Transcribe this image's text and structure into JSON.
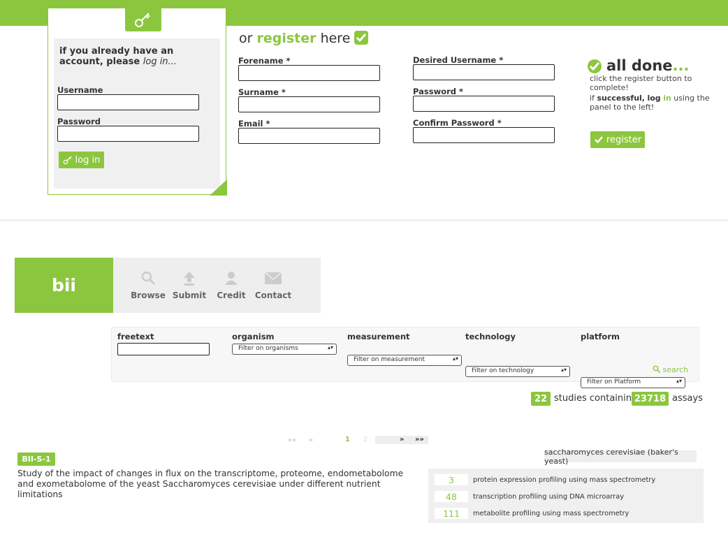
{
  "login": {
    "heading_prefix": "if you already have an account, please",
    "heading_italic": "log in...",
    "username_label": "Username",
    "username_value": "",
    "password_label": "Password",
    "password_value": "",
    "button_label": "log in"
  },
  "register": {
    "title_prefix": "or",
    "title_link": "register",
    "title_suffix": "here",
    "fields": {
      "forename": "Forename *",
      "surname": "Surname *",
      "email": "Email *",
      "desired_username": "Desired Username *",
      "password": "Password *",
      "confirm_password": "Confirm Password *"
    },
    "done_title": "all done",
    "done_dots": "...",
    "done_line1": "click the register button to complete!",
    "done_if": "if",
    "done_successful": "successful,",
    "done_log": "log",
    "done_in": "in",
    "done_rest": "using the panel to the left!",
    "button_label": "register"
  },
  "nav": {
    "logo": "bii",
    "items": [
      "Browse",
      "Submit",
      "Credit",
      "Contact"
    ]
  },
  "filters": {
    "freetext_label": "freetext",
    "freetext_value": "",
    "organism_label": "organism",
    "organism_value": "Filter on organisms",
    "measurement_label": "measurement",
    "measurement_value": "Filter on measurement",
    "technology_label": "technology",
    "technology_value": "Filter on technology",
    "platform_label": "platform",
    "platform_value": "Filter on Platform",
    "search_label": "search"
  },
  "summary": {
    "studies_count": "22",
    "studies_text": "studies containing",
    "assays_count": "23718",
    "assays_text": "assays"
  },
  "pagination": {
    "first": "««",
    "prev": "«",
    "current": "1",
    "next_page": "2",
    "next": "»",
    "last": "»»"
  },
  "study": {
    "id": "BII-S-1",
    "description": "Study of the impact of changes in flux on the transcriptome, proteome, endometabolome and exometabolome of the yeast Saccharomyces cerevisiae under different nutrient limitations",
    "organism": "saccharomyces cerevisiae (baker's yeast)",
    "assays": [
      {
        "count": "3",
        "label": "protein expression profiling using mass spectrometry"
      },
      {
        "count": "48",
        "label": "transcription profiling using DNA microarray"
      },
      {
        "count": "111",
        "label": "metabolite profiling using mass spectrometry"
      }
    ]
  },
  "colors": {
    "accent": "#8cc63f",
    "panel_bg": "#f0f0f0"
  },
  "icons": [
    "key-icon",
    "check-icon",
    "search-icon",
    "upload-icon",
    "person-icon",
    "envelope-icon"
  ]
}
